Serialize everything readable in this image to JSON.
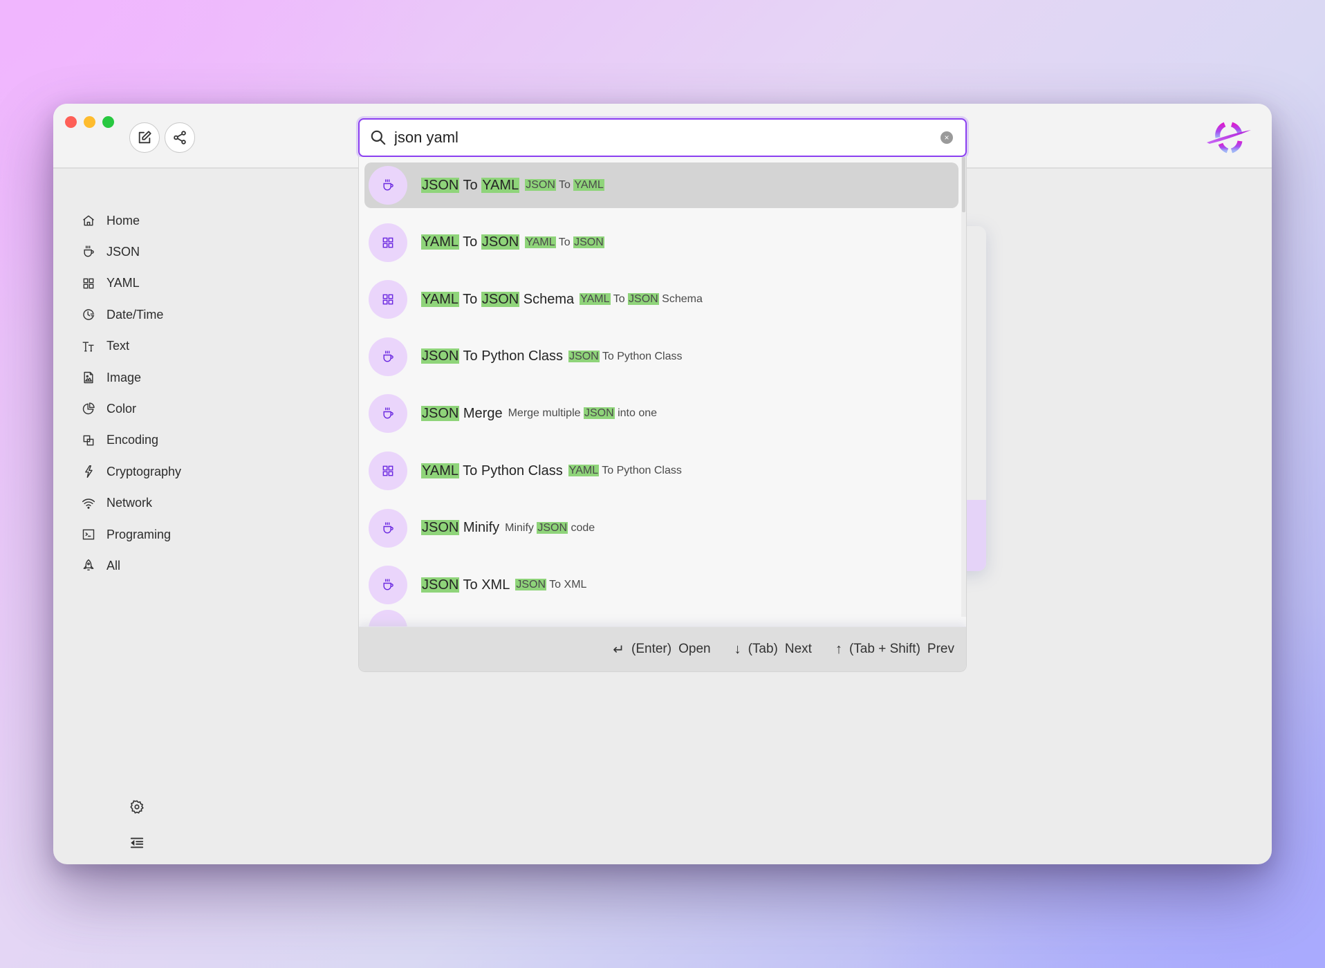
{
  "window": {
    "traffic_lights": [
      "close",
      "minimize",
      "maximize"
    ],
    "toolbar": {
      "edit_icon": "edit-icon",
      "share_icon": "share-icon"
    },
    "logo": "app-logo"
  },
  "search": {
    "value": "json yaml",
    "placeholder": "Search",
    "icon": "search-icon",
    "clear_label": "×"
  },
  "sidebar": {
    "items": [
      {
        "label": "Home",
        "icon": "home-icon"
      },
      {
        "label": "JSON",
        "icon": "cup-icon"
      },
      {
        "label": "YAML",
        "icon": "grid-icon"
      },
      {
        "label": "Date/Time",
        "icon": "clock-icon"
      },
      {
        "label": "Text",
        "icon": "text-size-icon"
      },
      {
        "label": "Image",
        "icon": "image-file-icon"
      },
      {
        "label": "Color",
        "icon": "pie-chart-icon"
      },
      {
        "label": "Encoding",
        "icon": "layers-icon"
      },
      {
        "label": "Cryptography",
        "icon": "bolt-icon"
      },
      {
        "label": "Network",
        "icon": "wifi-icon"
      },
      {
        "label": "Programing",
        "icon": "terminal-icon"
      },
      {
        "label": "All",
        "icon": "rocket-icon"
      }
    ],
    "bottom": {
      "settings_icon": "gear-icon",
      "collapse_icon": "collapse-sidebar-icon"
    }
  },
  "results": [
    {
      "icon": "cup",
      "active": true,
      "title": [
        [
          "JSON",
          true
        ],
        [
          " To ",
          false
        ],
        [
          "YAML",
          true
        ]
      ],
      "desc": [
        [
          "JSON",
          true
        ],
        [
          " To ",
          false
        ],
        [
          "YAML",
          true
        ]
      ]
    },
    {
      "icon": "grid",
      "active": false,
      "title": [
        [
          "YAML",
          true
        ],
        [
          " To ",
          false
        ],
        [
          "JSON",
          true
        ]
      ],
      "desc": [
        [
          "YAML",
          true
        ],
        [
          " To ",
          false
        ],
        [
          "JSON",
          true
        ]
      ]
    },
    {
      "icon": "grid",
      "active": false,
      "title": [
        [
          "YAML",
          true
        ],
        [
          " To ",
          false
        ],
        [
          "JSON",
          true
        ],
        [
          " Schema",
          false
        ]
      ],
      "desc": [
        [
          "YAML",
          true
        ],
        [
          " To ",
          false
        ],
        [
          "JSON",
          true
        ],
        [
          " Schema",
          false
        ]
      ]
    },
    {
      "icon": "cup",
      "active": false,
      "title": [
        [
          "JSON",
          true
        ],
        [
          " To Python Class",
          false
        ]
      ],
      "desc": [
        [
          "JSON",
          true
        ],
        [
          " To Python Class",
          false
        ]
      ]
    },
    {
      "icon": "cup",
      "active": false,
      "title": [
        [
          "JSON",
          true
        ],
        [
          " Merge",
          false
        ]
      ],
      "desc": [
        [
          "Merge multiple ",
          false
        ],
        [
          "JSON",
          true
        ],
        [
          " into one",
          false
        ]
      ]
    },
    {
      "icon": "grid",
      "active": false,
      "title": [
        [
          "YAML",
          true
        ],
        [
          " To Python Class",
          false
        ]
      ],
      "desc": [
        [
          "YAML",
          true
        ],
        [
          " To Python Class",
          false
        ]
      ]
    },
    {
      "icon": "cup",
      "active": false,
      "title": [
        [
          "JSON",
          true
        ],
        [
          " Minify",
          false
        ]
      ],
      "desc": [
        [
          "Minify ",
          false
        ],
        [
          "JSON",
          true
        ],
        [
          " code",
          false
        ]
      ]
    },
    {
      "icon": "cup",
      "active": false,
      "title": [
        [
          "JSON",
          true
        ],
        [
          " To XML",
          false
        ]
      ],
      "desc": [
        [
          "JSON",
          true
        ],
        [
          " To XML",
          false
        ]
      ]
    }
  ],
  "footer": {
    "hints": [
      {
        "icon": "↵",
        "icon_name": "enter-icon",
        "key": "(Enter)",
        "action": "Open"
      },
      {
        "icon": "↓",
        "icon_name": "arrow-down-icon",
        "key": "(Tab)",
        "action": "Next"
      },
      {
        "icon": "↑",
        "icon_name": "arrow-up-icon",
        "key": "(Tab + Shift)",
        "action": "Prev"
      }
    ]
  },
  "colors": {
    "accent": "#8b3ff0",
    "highlight": "#8fd47a",
    "icon_bg": "#ead5fb",
    "icon_fg": "#6a28e0"
  }
}
